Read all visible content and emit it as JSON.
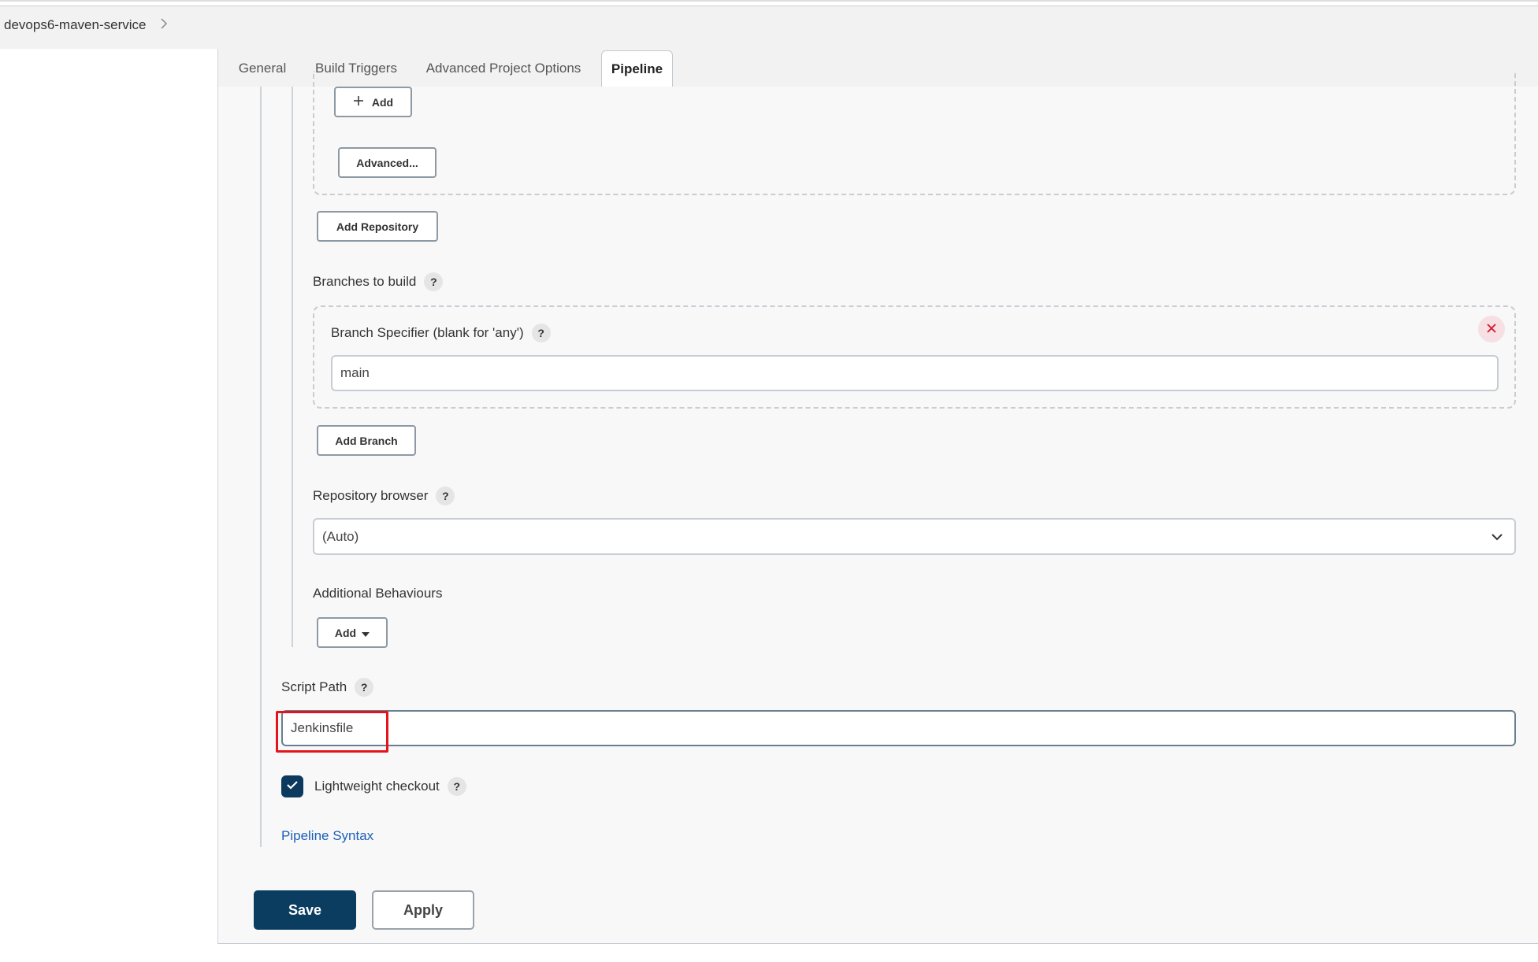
{
  "breadcrumb": {
    "items": [
      "devops6-maven-service"
    ],
    "separator_icon": "chevron-right-icon"
  },
  "tabs": [
    {
      "label": "General",
      "active": false
    },
    {
      "label": "Build Triggers",
      "active": false
    },
    {
      "label": "Advanced Project Options",
      "active": false
    },
    {
      "label": "Pipeline",
      "active": true
    }
  ],
  "credentials": {
    "add_label": "Add",
    "add_icon": "plus-icon",
    "advanced_label": "Advanced..."
  },
  "add_repository_label": "Add Repository",
  "branches": {
    "section_label": "Branches to build",
    "specifier_label": "Branch Specifier (blank for 'any')",
    "specifier_value": "main",
    "add_branch_label": "Add Branch",
    "remove_icon": "close-icon"
  },
  "repository_browser": {
    "label": "Repository browser",
    "selected": "(Auto)"
  },
  "additional_behaviours": {
    "label": "Additional Behaviours",
    "add_label": "Add"
  },
  "script_path": {
    "label": "Script Path",
    "value": "Jenkinsfile"
  },
  "lightweight_checkout": {
    "label": "Lightweight checkout",
    "checked": true
  },
  "pipeline_syntax_link": "Pipeline Syntax",
  "help_glyph": "?",
  "actions": {
    "save": "Save",
    "apply": "Apply"
  },
  "colors": {
    "primary": "#0b3d60",
    "link": "#1d5fb6",
    "highlight": "#e4141d",
    "danger": "#d9142b"
  }
}
